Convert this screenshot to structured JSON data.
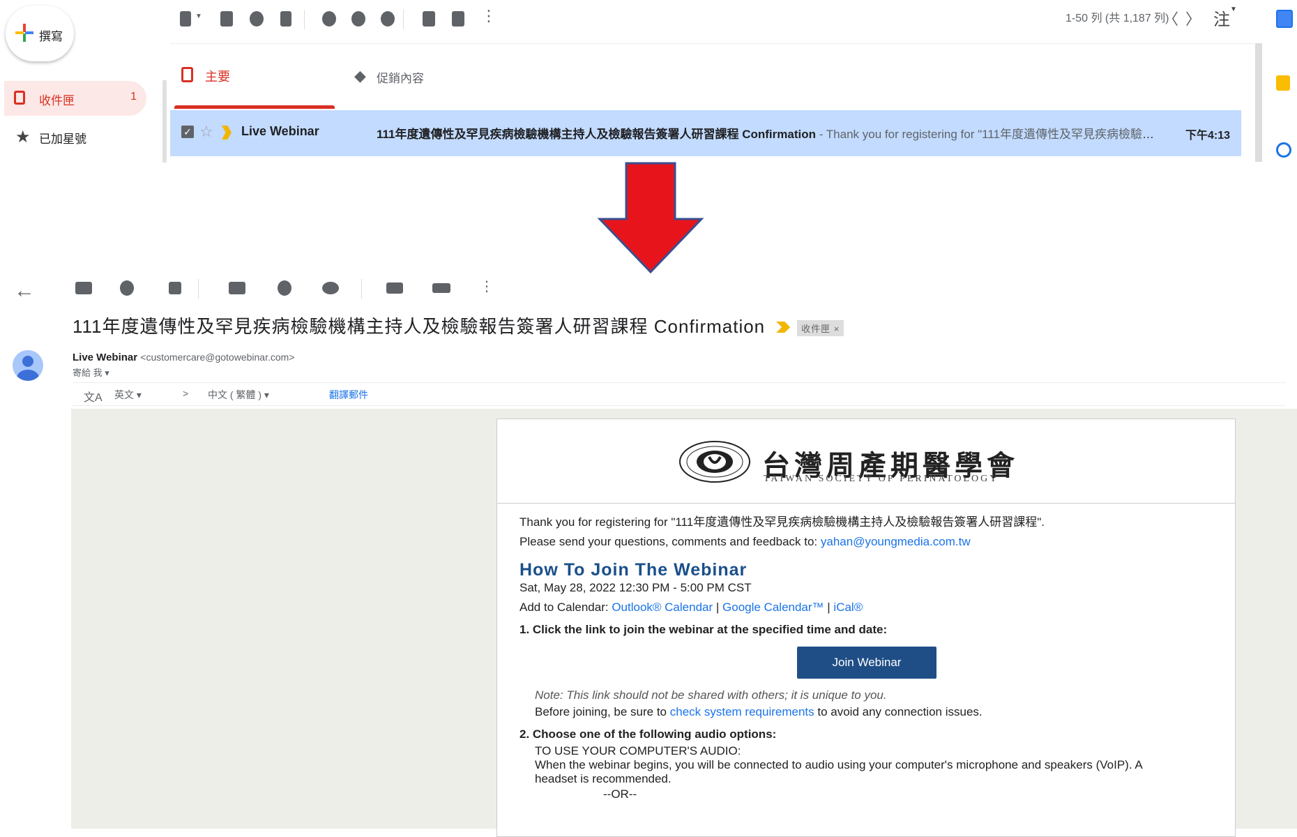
{
  "sidebar": {
    "compose_label": "撰寫",
    "inbox_label": "收件匣",
    "inbox_count": "1",
    "starred_label": "已加星號"
  },
  "list_toolbar": {
    "pager_text": "1-50 列 (共 1,187 列)",
    "prev": "〈",
    "next": "〉",
    "lang_glyph": "注"
  },
  "tabs": {
    "primary": "主要",
    "promotions": "促銷內容"
  },
  "row": {
    "sender": "Live Webinar",
    "subject": "111年度遺傳性及罕見疾病檢驗機構主持人及檢驗報告簽署人研習課程 Confirmation",
    "snippet": " - Thank you for registering for \"111年度遺傳性及罕見疾病檢驗機構主持人及檢驗報告簽署人研習課程...",
    "time": "下午4:13"
  },
  "email": {
    "subject": "111年度遺傳性及罕見疾病檢驗機構主持人及檢驗報告簽署人研習課程 Confirmation",
    "label_chip": "收件匣 ×",
    "sender_name": "Live Webinar",
    "sender_addr": "<customercare@gotowebinar.com>",
    "to_me": "寄給 我 ▾",
    "translate": {
      "icon": "文A",
      "from_lang": "英文 ▾",
      "arrow": ">",
      "to_lang": "中文 ( 繁體 ) ▾",
      "action": "翻譯郵件"
    },
    "logo_title": "台灣周產期醫學會",
    "logo_sub": "TAIWAN SOCIETY OF PERINATOLOGY",
    "thanks": "Thank you for registering for \"111年度遺傳性及罕見疾病檢驗機構主持人及檢驗報告簽署人研習課程\".",
    "feedback_prefix": "Please send your questions, comments and feedback to: ",
    "feedback_email": "yahan@youngmedia.com.tw",
    "howto_title": "How To Join The Webinar",
    "datetime": "Sat, May 28, 2022 12:30 PM - 5:00 PM CST",
    "add_cal_prefix": "Add to Calendar: ",
    "cal_outlook": "Outlook® Calendar",
    "cal_sep1": " | ",
    "cal_google": "Google Calendar™",
    "cal_sep2": " | ",
    "cal_ical": "iCal®",
    "step1": "1. Click the link to join the webinar at the specified time and date:",
    "join_btn": "Join Webinar",
    "note": "Note: This link should not be shared with others; it is unique to you.",
    "before_prefix": "Before joining, be sure to ",
    "before_link": "check system requirements",
    "before_suffix": " to avoid any connection issues.",
    "step2": "2. Choose one of the following audio options:",
    "audio_title": "TO USE YOUR COMPUTER'S AUDIO:",
    "audio_desc": "When the webinar begins, you will be connected to audio using your computer's microphone and speakers (VoIP). A headset is recommended.",
    "or": "--OR--"
  },
  "colors": {
    "accent_red": "#d93025",
    "selected_row": "#c2dbff",
    "arrow_red": "#e8141c",
    "arrow_outline": "#3a4f8f",
    "heading_blue": "#1a4f8a",
    "button_blue": "#1f4e87"
  }
}
